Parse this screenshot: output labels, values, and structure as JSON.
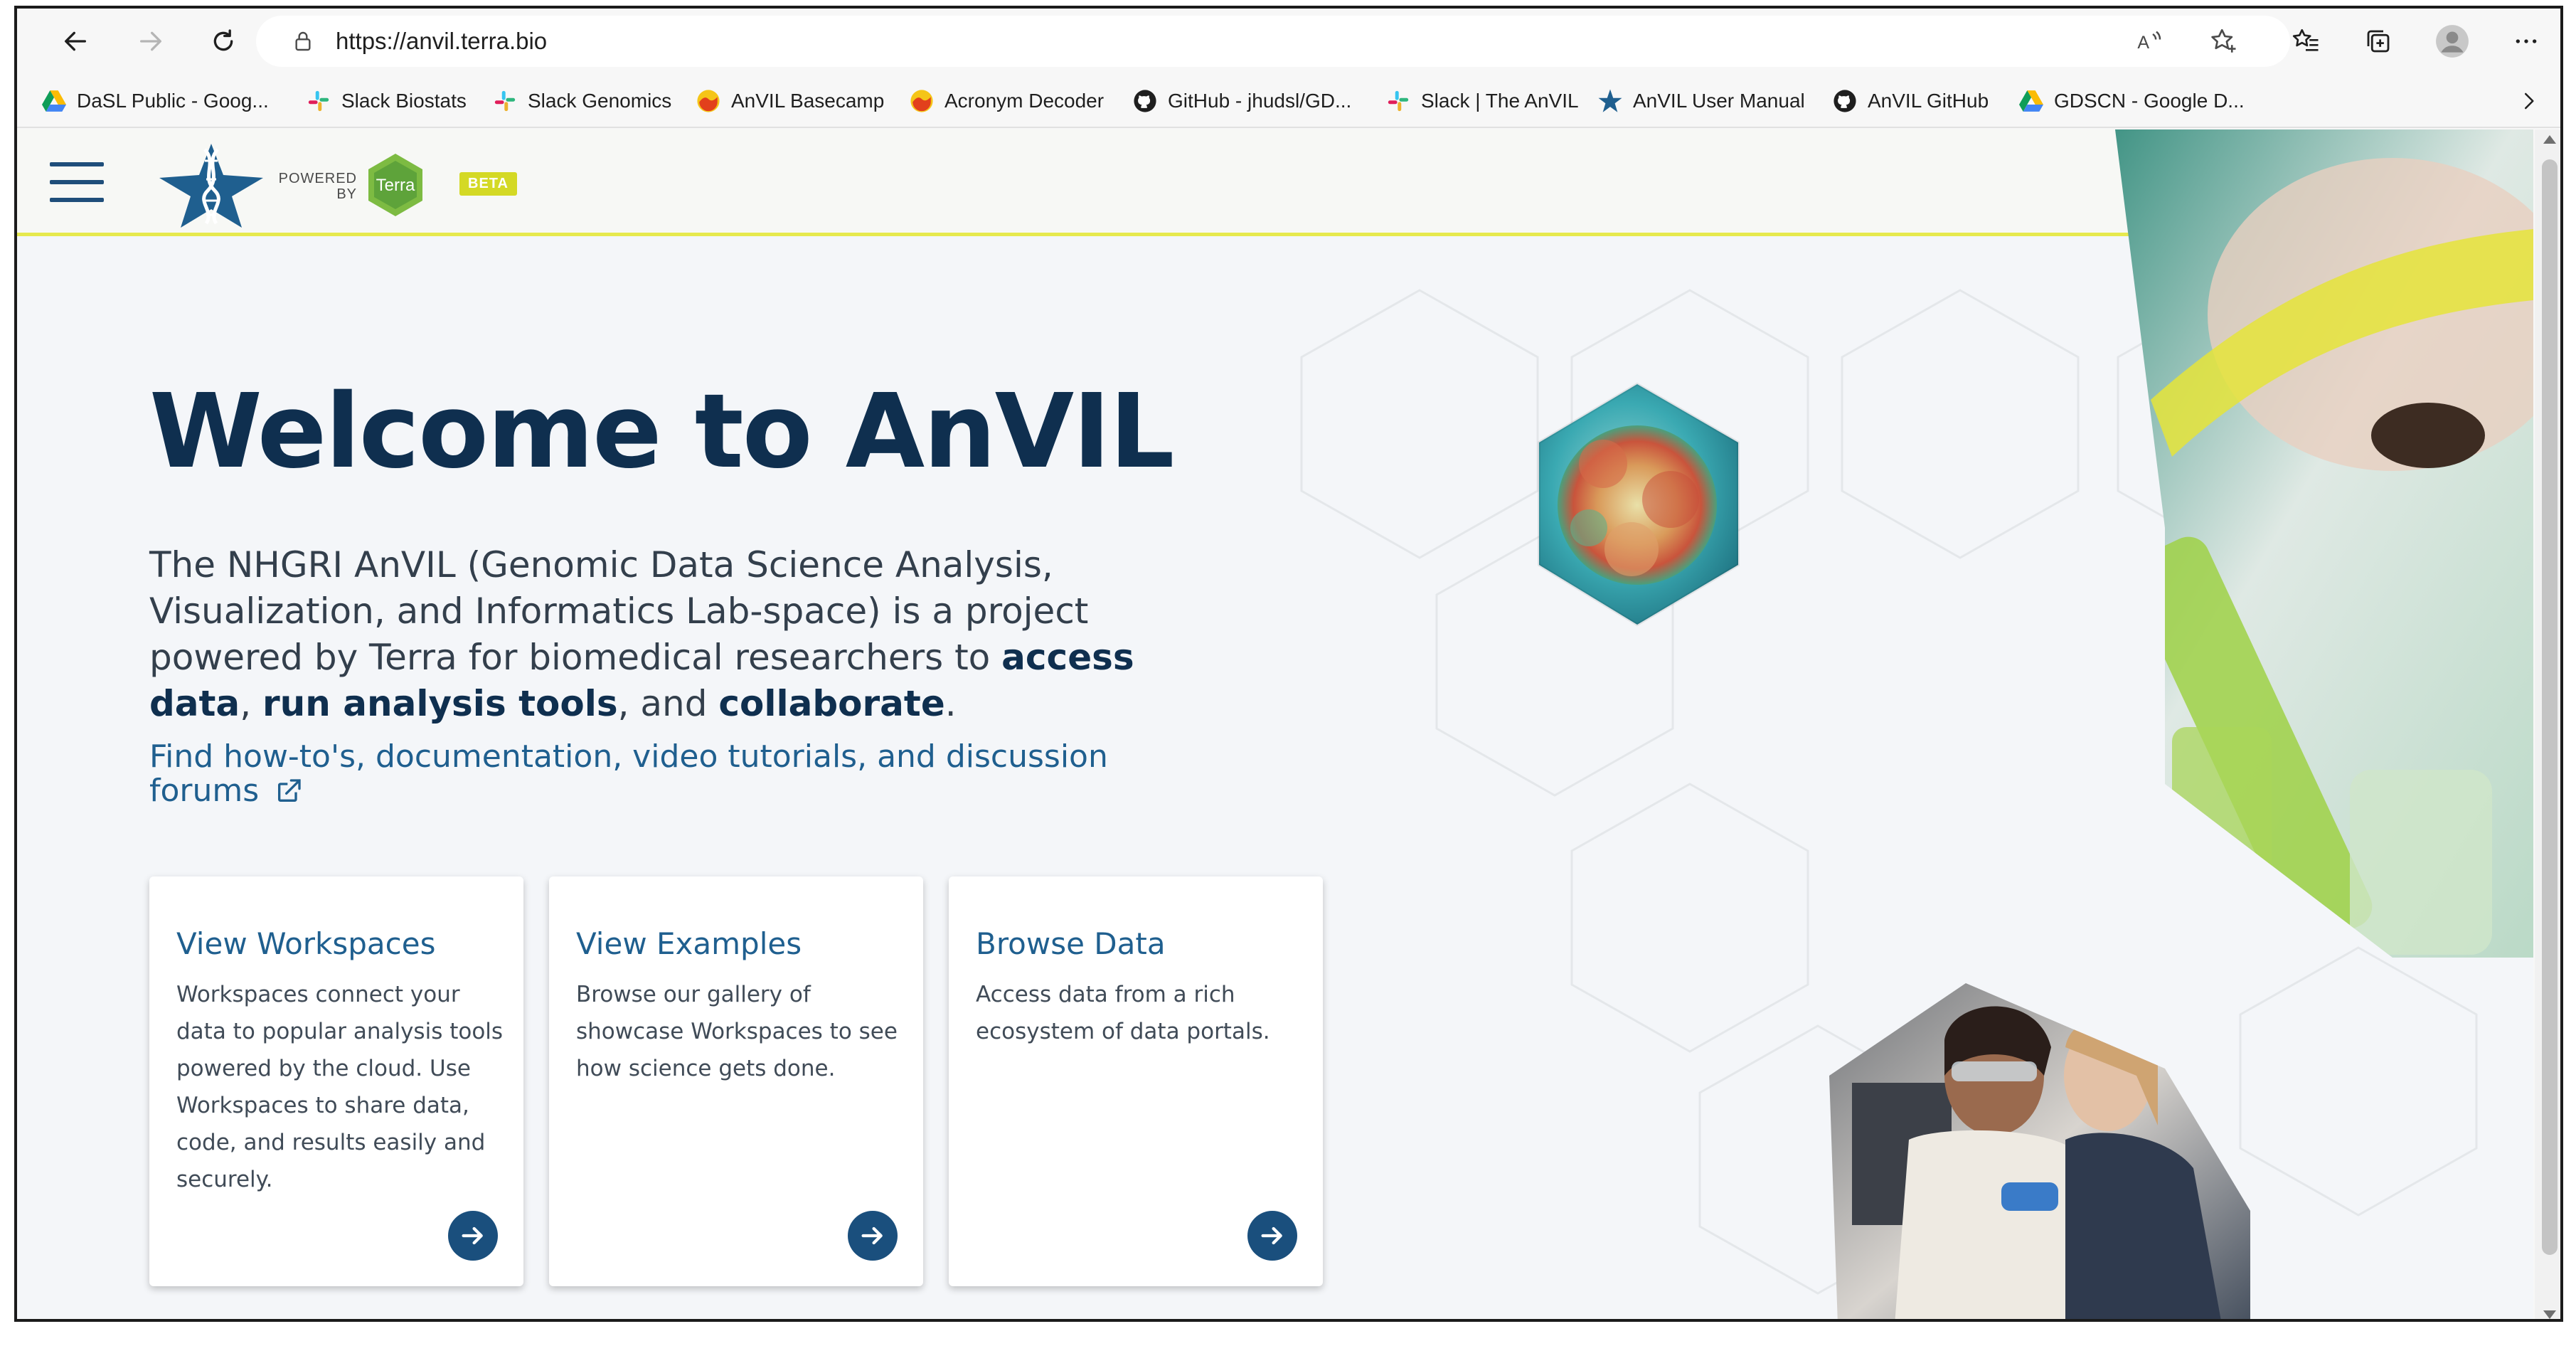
{
  "browser": {
    "url": "https://anvil.terra.bio",
    "bookmarks": [
      {
        "label": "DaSL Public - Goog...",
        "icon": "google-drive-icon"
      },
      {
        "label": "Slack Biostats",
        "icon": "slack-icon"
      },
      {
        "label": "Slack Genomics",
        "icon": "slack-icon"
      },
      {
        "label": "AnVIL Basecamp",
        "icon": "basecamp-icon"
      },
      {
        "label": "Acronym Decoder",
        "icon": "basecamp-icon"
      },
      {
        "label": "GitHub - jhudsl/GD...",
        "icon": "github-icon"
      },
      {
        "label": "Slack | The AnVIL",
        "icon": "slack-icon"
      },
      {
        "label": "AnVIL User Manual",
        "icon": "anvil-star-icon"
      },
      {
        "label": "AnVIL GitHub",
        "icon": "github-icon"
      },
      {
        "label": "GDSCN - Google D...",
        "icon": "google-drive-icon"
      }
    ]
  },
  "header": {
    "powered_by": "POWERED BY",
    "terra": "Terra",
    "beta": "BETA"
  },
  "hero": {
    "title": "Welcome to AnVIL",
    "desc_part1": "The NHGRI AnVIL (Genomic Data Science Analysis, Visualization, and Informatics Lab-space) is a project powered by Terra for biomedical researchers to ",
    "bold1": "access data",
    "sep1": ", ",
    "bold2": "run analysis tools",
    "sep2": ", and ",
    "bold3": "collaborate",
    "end": ".",
    "link": "Find how-to's, documentation, video tutorials, and discussion forums"
  },
  "cards": [
    {
      "title": "View Workspaces",
      "text": "Workspaces connect your data to popular analysis tools powered by the cloud. Use Workspaces to share data, code, and results easily and securely."
    },
    {
      "title": "View Examples",
      "text": "Browse our gallery of showcase Workspaces to see how science gets done."
    },
    {
      "title": "Browse Data",
      "text": "Access data from a rich ecosystem of data portals."
    }
  ],
  "colors": {
    "brand_navy": "#0f2f4f",
    "link_blue": "#1f5f8f",
    "header_accent": "#e6e94e",
    "terra_green": "#7dbb42"
  }
}
